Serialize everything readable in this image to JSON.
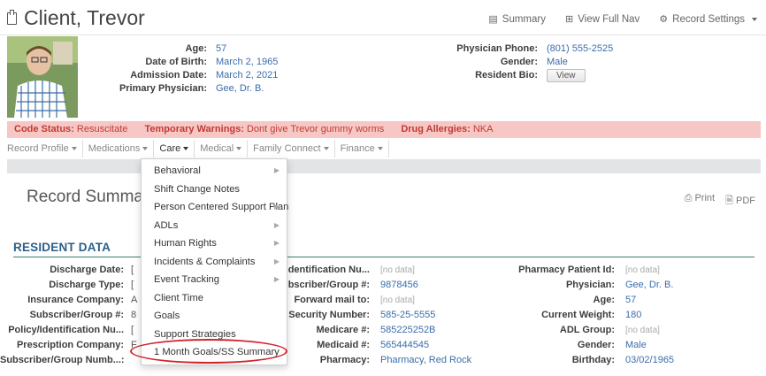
{
  "header": {
    "title": "Client, Trevor",
    "links": [
      {
        "label": "Summary",
        "icon": "summary-icon"
      },
      {
        "label": "View Full Nav",
        "icon": "expand-icon"
      },
      {
        "label": "Record Settings",
        "icon": "gear-icon"
      }
    ]
  },
  "demographics": {
    "left": [
      {
        "label": "Age:",
        "value": "57"
      },
      {
        "label": "Date of Birth:",
        "value": "March 2, 1965"
      },
      {
        "label": "Admission Date:",
        "value": "March 2, 2021"
      },
      {
        "label": "Primary Physician:",
        "value": "Gee, Dr. B."
      }
    ],
    "right": [
      {
        "label": "Physician Phone:",
        "value": "(801) 555-2525"
      },
      {
        "label": "Gender:",
        "value": "Male"
      },
      {
        "label": "Resident Bio:",
        "button": "View"
      }
    ]
  },
  "warnings": [
    {
      "label": "Code Status:",
      "value": "Resuscitate"
    },
    {
      "label": "Temporary Warnings:",
      "value": "Dont give Trevor gummy worms"
    },
    {
      "label": "Drug Allergies:",
      "value": "NKA"
    }
  ],
  "nav": [
    {
      "label": "Record Profile"
    },
    {
      "label": "Medications"
    },
    {
      "label": "Care"
    },
    {
      "label": "Medical"
    },
    {
      "label": "Family Connect"
    },
    {
      "label": "Finance"
    }
  ],
  "record_summary": {
    "title": "Record Summary",
    "print_label": "Print",
    "pdf_label": "PDF"
  },
  "resident_data": {
    "heading": "RESIDENT DATA",
    "col1": [
      {
        "label": "Discharge Date:"
      },
      {
        "label": "Discharge Type:"
      },
      {
        "label": "Insurance Company:"
      },
      {
        "label": "Subscriber/Group #:"
      },
      {
        "label": "Policy/Identification Nu..."
      },
      {
        "label": "Prescription Company:"
      },
      {
        "label": "Subscriber/Group Numb...:"
      }
    ],
    "col1_partial": [
      "[",
      "[",
      "A",
      "8",
      "[",
      "F",
      ""
    ],
    "col2": [
      {
        "label": "y/Identification Nu...",
        "value": "[no data]"
      },
      {
        "label": "Subscriber/Group #:",
        "value": "9878456"
      },
      {
        "label": "Forward mail to:",
        "value": "[no data]"
      },
      {
        "label": "cial Security Number:",
        "value": "585-25-5555"
      },
      {
        "label": "Medicare #:",
        "value": "585225252B"
      },
      {
        "label": "Medicaid #:",
        "value": "565444545"
      },
      {
        "label": "Pharmacy:",
        "value": "Pharmacy, Red Rock"
      }
    ],
    "col3": [
      {
        "label": "Pharmacy Patient Id:",
        "value": "[no data]"
      },
      {
        "label": "Physician:",
        "value": "Gee, Dr. B."
      },
      {
        "label": "Age:",
        "value": "57"
      },
      {
        "label": "Current Weight:",
        "value": "180"
      },
      {
        "label": "ADL Group:",
        "value": "[no data]"
      },
      {
        "label": "Gender:",
        "value": "Male"
      },
      {
        "label": "Birthday:",
        "value": "03/02/1965"
      }
    ]
  },
  "care_menu": {
    "items": [
      {
        "label": "Behavioral",
        "has_submenu": true
      },
      {
        "label": "Shift Change Notes",
        "has_submenu": false
      },
      {
        "label": "Person Centered Support Plan",
        "has_submenu": true
      },
      {
        "label": "ADLs",
        "has_submenu": true
      },
      {
        "label": "Human Rights",
        "has_submenu": true
      },
      {
        "label": "Incidents & Complaints",
        "has_submenu": true
      },
      {
        "label": "Event Tracking",
        "has_submenu": true
      },
      {
        "label": "Client Time",
        "has_submenu": false
      },
      {
        "label": "Goals",
        "has_submenu": false
      },
      {
        "label": "Support Strategies",
        "has_submenu": false
      },
      {
        "label": "1 Month Goals/SS Summary",
        "has_submenu": false
      }
    ],
    "highlighted_item": "1 Month Goals/SS Summary"
  },
  "colors": {
    "warning_bg": "#f6c7c4",
    "warning_text": "#c03b33",
    "link_blue": "#3b6dab",
    "section_heading": "#2c5f8a",
    "highlight_ring": "#d2242b"
  }
}
